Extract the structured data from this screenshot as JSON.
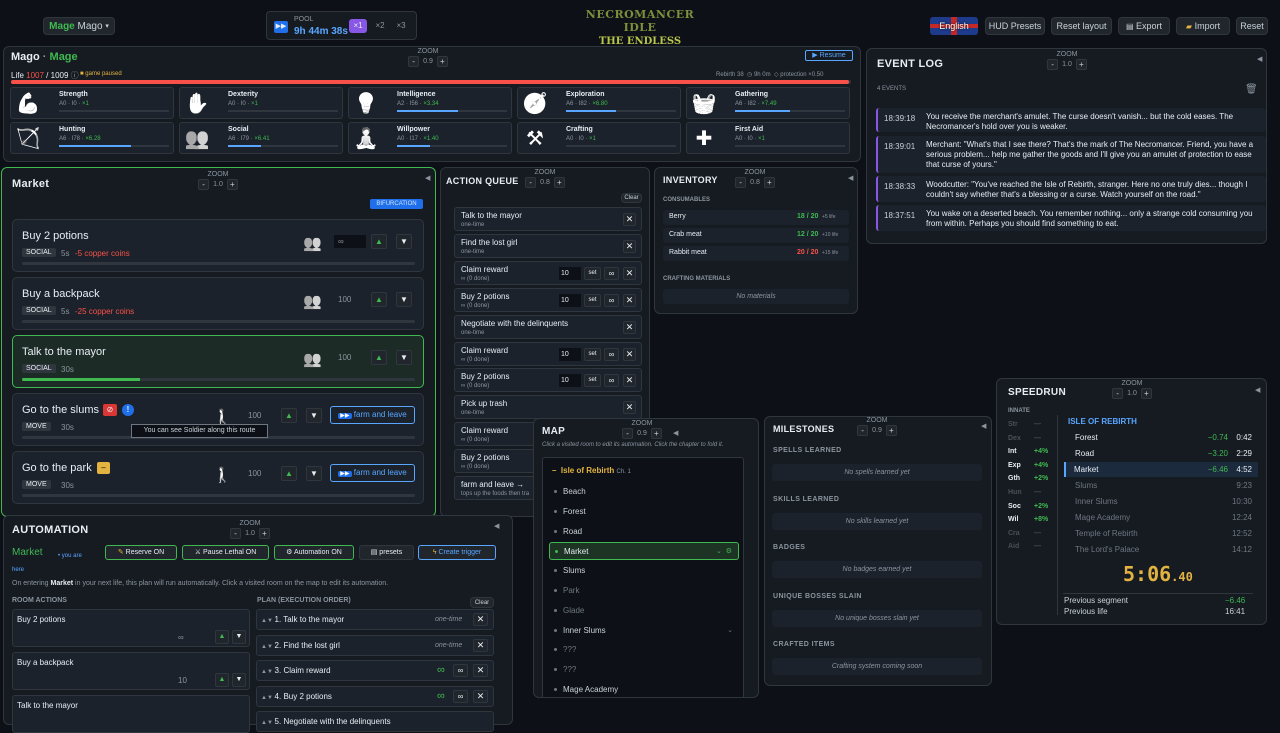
{
  "topbar": {
    "char_name": "Mage",
    "char_user": "Mago",
    "pool_label": "POOL",
    "pool_time": "9h 44m 38s",
    "speeds": [
      "×1",
      "×2",
      "×3"
    ],
    "logo_line1": "NECROMANCER IDLE",
    "logo_line2": "THE ENDLESS DRAIN",
    "language": "English",
    "hud_presets": "HUD Presets",
    "reset_layout": "Reset layout",
    "export": "Export",
    "import": "Import",
    "reset": "Reset"
  },
  "zoom": {
    "label": "ZOOM",
    "v09": "0.9",
    "v10": "1.0",
    "v08": "0.8",
    "minus": "-",
    "plus": "+"
  },
  "character": {
    "name": "Mago",
    "class": "Mage",
    "sep": "·",
    "resume": "Resume",
    "life_label": "Life",
    "life_cur": "1007",
    "life_max": "/ 1009",
    "paused": "game paused",
    "rebirth": "Rebirth 38",
    "time": "9h 0m",
    "protection": "protection ×0.50",
    "life_pct": 99.8
  },
  "skills": [
    {
      "name": "Strength",
      "icon": "arm-icon",
      "stat": "A0 · I0 · ",
      "gain": "×1",
      "p": 0
    },
    {
      "name": "Dexterity",
      "icon": "dexterity-icon",
      "stat": "A0 · I0 · ",
      "gain": "×1",
      "p": 0
    },
    {
      "name": "Intelligence",
      "icon": "bulb-icon",
      "stat": "A2 · I56 · ",
      "gain": "×3.34",
      "p": 55
    },
    {
      "name": "Exploration",
      "icon": "compass-icon",
      "stat": "A6 · I82 · ",
      "gain": "×6.80",
      "p": 45
    },
    {
      "name": "Gathering",
      "icon": "basket-icon",
      "stat": "A6 · I82 · ",
      "gain": "×7.49",
      "p": 50
    },
    {
      "name": "Hunting",
      "icon": "bow-icon",
      "stat": "A6 · I78 · ",
      "gain": "×6.28",
      "p": 65
    },
    {
      "name": "Social",
      "icon": "social-icon",
      "stat": "A6 · I79 · ",
      "gain": "×6.41",
      "p": 30
    },
    {
      "name": "Willpower",
      "icon": "meditate-icon",
      "stat": "A0 · I17 · ",
      "gain": "×1.40",
      "p": 30
    },
    {
      "name": "Crafting",
      "icon": "anvil-icon",
      "stat": "A0 · I0 · ",
      "gain": "×1",
      "p": 0
    },
    {
      "name": "First Aid",
      "icon": "cross-icon",
      "stat": "A0 · I0 · ",
      "gain": "×1",
      "p": 0
    }
  ],
  "market": {
    "title": "Market",
    "bifurcation": "BIFURCATION",
    "tooltip": "You can see Soldier along this route",
    "farm_leave": "farm and leave",
    "actions": [
      {
        "name": "Buy 2 potions",
        "tag": "SOCIAL",
        "time": "5s",
        "cost": "-5 copper coins",
        "num": "∞",
        "p": 0
      },
      {
        "name": "Buy a backpack",
        "tag": "SOCIAL",
        "time": "5s",
        "cost": "-25 copper coins",
        "num": "100",
        "p": 0
      },
      {
        "name": "Talk to the mayor",
        "tag": "SOCIAL",
        "time": "30s",
        "cost": "",
        "num": "100",
        "p": 30
      },
      {
        "name": "Go to the slums",
        "tag": "MOVE",
        "time": "30s",
        "cost": "",
        "num": "100",
        "p": 0
      },
      {
        "name": "Go to the park",
        "tag": "MOVE",
        "time": "30s",
        "cost": "",
        "num": "100",
        "p": 0
      }
    ]
  },
  "queue": {
    "title": "ACTION QUEUE",
    "clear": "Clear",
    "set": "set",
    "inf": "∞",
    "x": "✕",
    "items": [
      {
        "name": "Talk to the mayor",
        "sub": "one-time",
        "num": ""
      },
      {
        "name": "Find the lost girl",
        "sub": "one-time",
        "num": ""
      },
      {
        "name": "Claim reward",
        "sub": "∞ (0 done)",
        "num": "10"
      },
      {
        "name": "Buy 2 potions",
        "sub": "∞ (0 done)",
        "num": "10"
      },
      {
        "name": "Negotiate with the delinquents",
        "sub": "one-time",
        "num": ""
      },
      {
        "name": "Claim reward",
        "sub": "∞ (0 done)",
        "num": "10"
      },
      {
        "name": "Buy 2 potions",
        "sub": "∞ (0 done)",
        "num": "10"
      },
      {
        "name": "Pick up trash",
        "sub": "one-time",
        "num": ""
      },
      {
        "name": "Claim reward",
        "sub": "∞ (0 done)",
        "num": ""
      },
      {
        "name": "Buy 2 potions",
        "sub": "∞ (0 done)",
        "num": ""
      },
      {
        "name": "farm and leave →",
        "sub": "tops up the foods then tra",
        "num": ""
      }
    ]
  },
  "inventory": {
    "title": "INVENTORY",
    "consumables": "CONSUMABLES",
    "crafting": "CRAFTING MATERIALS",
    "no_materials": "No materials",
    "items": [
      {
        "name": "Berry",
        "qty": "18 / 20",
        "eff": "+5 life",
        "color": "#3fb950"
      },
      {
        "name": "Crab meat",
        "qty": "12 / 20",
        "eff": "+10 life",
        "color": "#3fb950"
      },
      {
        "name": "Rabbit meat",
        "qty": "20 / 20",
        "eff": "+15 life",
        "color": "#f85149"
      }
    ]
  },
  "event_log": {
    "title": "EVENT LOG",
    "count": "4 EVENTS",
    "events": [
      {
        "time": "18:39:18",
        "text": "You receive the merchant's amulet. The curse doesn't vanish... but the cold eases. The Necromancer's hold over you is weaker."
      },
      {
        "time": "18:39:01",
        "text": "Merchant: \"What's that I see there? That's the mark of The Necromancer. Friend, you have a serious problem... help me gather the goods and I'll give you an amulet of protection to ease that curse of yours.\""
      },
      {
        "time": "18:38:33",
        "text": "Woodcutter: \"You've reached the Isle of Rebirth, stranger. Here no one truly dies... though I couldn't say whether that's a blessing or a curse. Watch yourself on the road.\""
      },
      {
        "time": "18:37:51",
        "text": "You wake on a deserted beach. You remember nothing... only a strange cold consuming you from within. Perhaps you should find something to eat."
      }
    ]
  },
  "map": {
    "title": "MAP",
    "hint": "Click a visited room to edit its automation. Click the chapter to fold it.",
    "chapter": "Isle of Rebirth",
    "ch": "Ch. 1",
    "rooms": [
      "Beach",
      "Forest",
      "Road",
      "Market",
      "Slums",
      "Park",
      "Glade",
      "Inner Slums",
      "???",
      "???",
      "Mage Academy"
    ]
  },
  "milestones": {
    "title": "MILESTONES",
    "sections": [
      {
        "label": "SPELLS LEARNED",
        "empty": "No spells learned yet"
      },
      {
        "label": "SKILLS LEARNED",
        "empty": "No skills learned yet"
      },
      {
        "label": "BADGES",
        "empty": "No badges earned yet"
      },
      {
        "label": "UNIQUE BOSSES SLAIN",
        "empty": "No unique bosses slain yet"
      },
      {
        "label": "CRAFTED ITEMS",
        "empty": "Crafting system coming soon"
      }
    ]
  },
  "speedrun": {
    "title": "SPEEDRUN",
    "innate": "INNATE",
    "region": "ISLE OF REBIRTH",
    "timer_main": "5:06",
    "timer_frac": ".40",
    "prev_segment": "Previous segment",
    "prev_segment_val": "−6.46",
    "prev_life": "Previous life",
    "prev_life_val": "16:41",
    "innates": [
      {
        "k": "Str",
        "v": "—",
        "on": false
      },
      {
        "k": "Dex",
        "v": "—",
        "on": false
      },
      {
        "k": "Int",
        "v": "+4%",
        "on": true
      },
      {
        "k": "Exp",
        "v": "+4%",
        "on": true
      },
      {
        "k": "Gth",
        "v": "+2%",
        "on": true
      },
      {
        "k": "Hun",
        "v": "—",
        "on": false
      },
      {
        "k": "Soc",
        "v": "+2%",
        "on": true
      },
      {
        "k": "Wil",
        "v": "+8%",
        "on": true
      },
      {
        "k": "Cra",
        "v": "—",
        "on": false
      },
      {
        "k": "Aid",
        "v": "—",
        "on": false
      }
    ],
    "splits": [
      {
        "n": "Forest",
        "d": "−0.74",
        "t": "0:42",
        "done": true
      },
      {
        "n": "Road",
        "d": "−3.20",
        "t": "2:29",
        "done": true
      },
      {
        "n": "Market",
        "d": "−6.46",
        "t": "4:52",
        "done": true
      },
      {
        "n": "Slums",
        "d": "",
        "t": "9:23",
        "done": false
      },
      {
        "n": "Inner Slums",
        "d": "",
        "t": "10:30",
        "done": false
      },
      {
        "n": "Mage Academy",
        "d": "",
        "t": "12:24",
        "done": false
      },
      {
        "n": "Temple of Rebirth",
        "d": "",
        "t": "12:52",
        "done": false
      },
      {
        "n": "The Lord's Palace",
        "d": "",
        "t": "14:12",
        "done": false
      }
    ]
  },
  "automation": {
    "title": "AUTOMATION",
    "room": "Market",
    "you_are_here": "• you are here",
    "reserve": "Reserve ON",
    "pause_lethal": "Pause Lethal ON",
    "auto_on": "Automation ON",
    "presets": "presets",
    "create_trigger": "Create trigger",
    "desc_a": "On entering ",
    "desc_b": "Market",
    "desc_c": " in your next life, this plan will run automatically. Click a visited room on the map to edit its automation.",
    "room_actions": "ROOM ACTIONS",
    "plan": "PLAN (EXECUTION ORDER)",
    "clear": "Clear",
    "actions": [
      {
        "name": "Buy 2 potions",
        "num": "∞"
      },
      {
        "name": "Buy a backpack",
        "num": "10"
      },
      {
        "name": "Talk to the mayor",
        "num": ""
      }
    ],
    "plan_items": [
      {
        "name": "1. Talk to the mayor",
        "mode": "one-time"
      },
      {
        "name": "2. Find the lost girl",
        "mode": "one-time"
      },
      {
        "name": "3. Claim reward",
        "mode": "∞"
      },
      {
        "name": "4. Buy 2 potions",
        "mode": "∞"
      },
      {
        "name": "5. Negotiate with the delinquents",
        "mode": ""
      }
    ]
  },
  "colors": {
    "accent": "#58a6ff",
    "green": "#3fb950",
    "red": "#f85149",
    "yellow": "#e3b341",
    "purple": "#8957e5"
  }
}
